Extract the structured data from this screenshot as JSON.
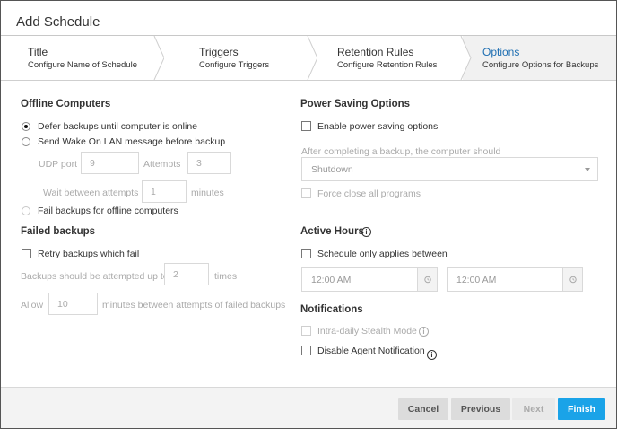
{
  "dialog": {
    "title": "Add Schedule"
  },
  "steps": [
    {
      "label": "Title",
      "sub": "Configure Name of Schedule"
    },
    {
      "label": "Triggers",
      "sub": "Configure Triggers"
    },
    {
      "label": "Retention Rules",
      "sub": "Configure Retention Rules"
    },
    {
      "label": "Options",
      "sub": "Configure Options for Backups"
    }
  ],
  "offline": {
    "heading": "Offline Computers",
    "defer_label": "Defer backups until computer is online",
    "wol_label": "Send Wake On LAN message before backup",
    "udp_label": "UDP port",
    "udp_value": "9",
    "attempts_label": "Attempts",
    "attempts_value": "3",
    "wait_label": "Wait between attempts",
    "wait_value": "1",
    "minutes_label": "minutes",
    "fail_label": "Fail backups for offline computers"
  },
  "failed": {
    "heading": "Failed backups",
    "retry_label": "Retry backups which fail",
    "attempt_prefix": "Backups should be attempted up to",
    "attempt_value": "2",
    "attempt_suffix": "times",
    "allow_prefix": "Allow",
    "allow_value": "10",
    "allow_suffix": "minutes between attempts of failed backups"
  },
  "power": {
    "heading": "Power Saving Options",
    "enable_label": "Enable power saving options",
    "after_label": "After completing a backup, the computer should",
    "select_value": "Shutdown",
    "force_label": "Force close all programs"
  },
  "active": {
    "heading": "Active Hours",
    "schedule_label": "Schedule only applies between",
    "start_time": "12:00 AM",
    "end_time": "12:00 AM"
  },
  "notifications": {
    "heading": "Notifications",
    "stealth_label": "Intra-daily Stealth Mode",
    "disable_label": "Disable Agent Notification"
  },
  "footer": {
    "cancel": "Cancel",
    "previous": "Previous",
    "next": "Next",
    "finish": "Finish"
  },
  "colors": {
    "accent": "#1aa3e8",
    "active_step": "#1f6fb2"
  }
}
